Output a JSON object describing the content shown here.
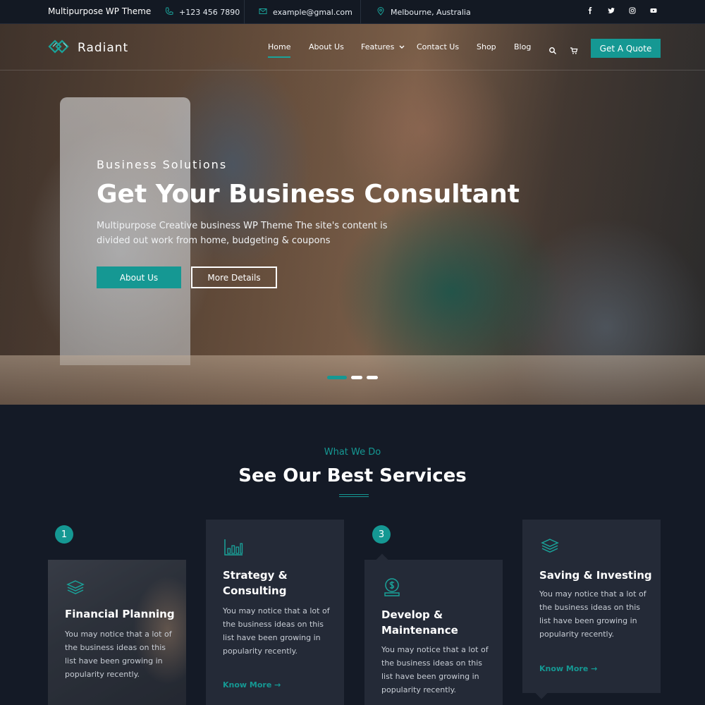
{
  "topbar": {
    "brand": "Multipurpose WP Theme",
    "phone": "+123 456 7890",
    "email": "example@gmal.com",
    "location": "Melbourne, Australia",
    "socials": [
      "facebook-icon",
      "twitter-icon",
      "instagram-icon",
      "youtube-icon"
    ]
  },
  "nav": {
    "logo_text": "Radiant",
    "items": [
      {
        "label": "Home",
        "active": true
      },
      {
        "label": "About Us"
      },
      {
        "label": "Features",
        "dropdown": true
      },
      {
        "label": "Contact Us"
      },
      {
        "label": "Shop"
      },
      {
        "label": "Blog"
      }
    ],
    "quote_button": "Get A Quote"
  },
  "hero": {
    "eyebrow": "Business Solutions",
    "headline": "Get Your Business Consultant",
    "subtext": "Multipurpose Creative business WP Theme The site's content is divided out work from home, budgeting & coupons",
    "primary_button": "About Us",
    "secondary_button": "More Details",
    "slides_total": 3,
    "active_slide": 1
  },
  "services": {
    "kicker": "What We Do",
    "title": "See Our Best Services",
    "cards": [
      {
        "number": "1",
        "icon": "layers-icon",
        "title": "Financial Planning",
        "desc": "You may notice that a lot of the business ideas on this list have been growing in popularity recently."
      },
      {
        "icon": "bar-chart-icon",
        "title": "Strategy & Consulting",
        "desc": "You may notice that a lot of the business ideas on this list have been growing in popularity recently.",
        "link": "Know More →"
      },
      {
        "number": "3",
        "icon": "dollar-coin-icon",
        "title": "Develop & Maintenance",
        "desc": "You may notice that a lot of the business ideas on this list have been growing in popularity recently."
      },
      {
        "icon": "layers-icon",
        "title": "Saving & Investing",
        "desc": "You may notice that a lot of the business ideas on this list have been growing in popularity recently.",
        "link": "Know More →"
      }
    ]
  },
  "colors": {
    "accent": "#159893",
    "background": "#141a26",
    "card": "#242a37"
  }
}
